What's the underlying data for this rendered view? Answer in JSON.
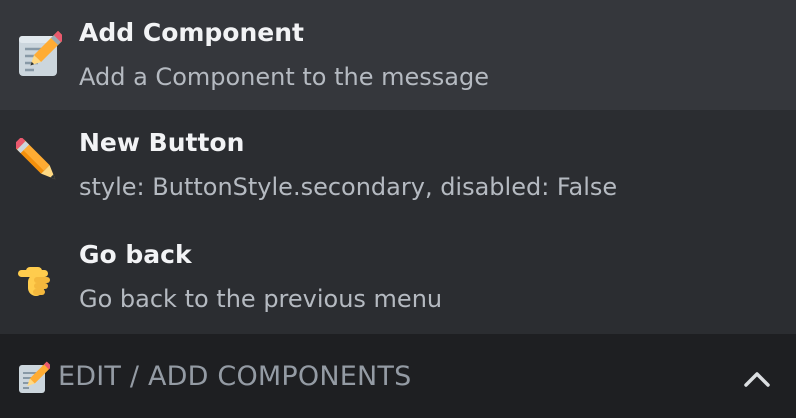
{
  "menu": {
    "options": [
      {
        "icon": "memo-icon",
        "title": "Add Component",
        "description": "Add a Component to the message"
      },
      {
        "icon": "pencil-icon",
        "title": "New Button",
        "description": "style: ButtonStyle.secondary, disabled: False"
      },
      {
        "icon": "pointing-right-icon",
        "title": "Go back",
        "description": "Go back to the previous menu"
      }
    ]
  },
  "select": {
    "icon": "memo-icon",
    "label": "EDIT / ADD COMPONENTS",
    "toggle_icon": "chevron-up-icon"
  },
  "colors": {
    "menu_background": "#2b2d31",
    "highlighted_option": "#35373c",
    "select_background": "#1e1f22",
    "title_text": "#f2f3f5",
    "description_text": "#b5bac1",
    "select_text": "#949ba4"
  }
}
